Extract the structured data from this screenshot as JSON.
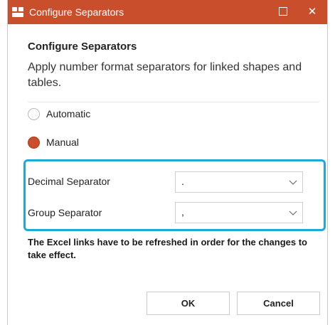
{
  "window": {
    "title": "Configure Separators",
    "maximize_icon": "maximize-icon",
    "close_glyph": "✕",
    "accent_color": "#c94f2c"
  },
  "dialog": {
    "heading": "Configure Separators",
    "description": "Apply number format separators for linked shapes and tables."
  },
  "mode": {
    "options": [
      {
        "label": "Automatic",
        "selected": false
      },
      {
        "label": "Manual",
        "selected": true
      }
    ]
  },
  "separators": {
    "highlight_color": "#1eaad3",
    "decimal": {
      "label": "Decimal Separator",
      "value": "."
    },
    "group": {
      "label": "Group Separator",
      "value": ","
    }
  },
  "notice": "The Excel links have to be refreshed in order for the changes to take effect.",
  "buttons": {
    "ok": "OK",
    "cancel": "Cancel"
  }
}
